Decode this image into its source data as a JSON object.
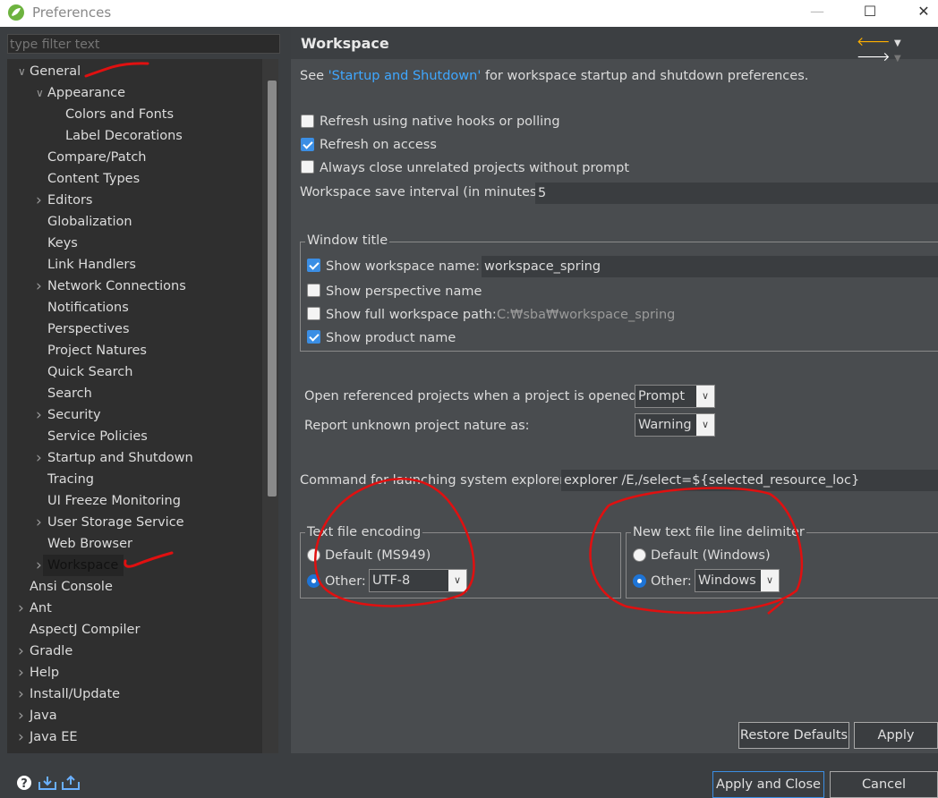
{
  "window": {
    "title": "Preferences"
  },
  "filter": {
    "placeholder": "type filter text"
  },
  "tree": [
    {
      "label": "General",
      "level": 0,
      "expanded": true,
      "icon": "chevron-down-icon"
    },
    {
      "label": "Appearance",
      "level": 1,
      "expanded": true,
      "icon": "chevron-down-icon"
    },
    {
      "label": "Colors and Fonts",
      "level": 2
    },
    {
      "label": "Label Decorations",
      "level": 2
    },
    {
      "label": "Compare/Patch",
      "level": 1
    },
    {
      "label": "Content Types",
      "level": 1
    },
    {
      "label": "Editors",
      "level": 1,
      "icon": "chevron-right-icon"
    },
    {
      "label": "Globalization",
      "level": 1
    },
    {
      "label": "Keys",
      "level": 1
    },
    {
      "label": "Link Handlers",
      "level": 1
    },
    {
      "label": "Network Connections",
      "level": 1,
      "icon": "chevron-right-icon"
    },
    {
      "label": "Notifications",
      "level": 1
    },
    {
      "label": "Perspectives",
      "level": 1
    },
    {
      "label": "Project Natures",
      "level": 1
    },
    {
      "label": "Quick Search",
      "level": 1
    },
    {
      "label": "Search",
      "level": 1
    },
    {
      "label": "Security",
      "level": 1,
      "icon": "chevron-right-icon"
    },
    {
      "label": "Service Policies",
      "level": 1
    },
    {
      "label": "Startup and Shutdown",
      "level": 1,
      "icon": "chevron-right-icon"
    },
    {
      "label": "Tracing",
      "level": 1
    },
    {
      "label": "UI Freeze Monitoring",
      "level": 1
    },
    {
      "label": "User Storage Service",
      "level": 1,
      "icon": "chevron-right-icon"
    },
    {
      "label": "Web Browser",
      "level": 1
    },
    {
      "label": "Workspace",
      "level": 1,
      "icon": "chevron-right-icon",
      "selected": true
    },
    {
      "label": "Ansi Console",
      "level": 0
    },
    {
      "label": "Ant",
      "level": 0,
      "icon": "chevron-right-icon"
    },
    {
      "label": "AspectJ Compiler",
      "level": 0
    },
    {
      "label": "Gradle",
      "level": 0,
      "icon": "chevron-right-icon"
    },
    {
      "label": "Help",
      "level": 0,
      "icon": "chevron-right-icon"
    },
    {
      "label": "Install/Update",
      "level": 0,
      "icon": "chevron-right-icon"
    },
    {
      "label": "Java",
      "level": 0,
      "icon": "chevron-right-icon"
    },
    {
      "label": "Java EE",
      "level": 0,
      "icon": "chevron-right-icon"
    }
  ],
  "page": {
    "title": "Workspace",
    "intro_pre": "See ",
    "intro_link": "'Startup and Shutdown'",
    "intro_post": " for workspace startup and shutdown preferences.",
    "refresh_native": {
      "label": "Refresh using native hooks or polling",
      "checked": false
    },
    "refresh_access": {
      "label": "Refresh on access",
      "checked": true
    },
    "always_close": {
      "label": "Always close unrelated projects without prompt",
      "checked": false
    },
    "save_interval_label": "Workspace save interval (in minutes):",
    "save_interval_value": "5",
    "window_title": {
      "group_label": "Window title",
      "show_workspace_name": {
        "label": "Show workspace name:",
        "checked": true,
        "value": "workspace_spring"
      },
      "show_perspective_name": {
        "label": "Show perspective name",
        "checked": false
      },
      "show_full_path": {
        "label": "Show full workspace path:",
        "checked": false,
        "value": "C:₩sba₩workspace_spring"
      },
      "show_product_name": {
        "label": "Show product name",
        "checked": true
      }
    },
    "open_referenced": {
      "label": "Open referenced projects when a project is opened:",
      "value": "Prompt"
    },
    "report_unknown": {
      "label": "Report unknown project nature as:",
      "value": "Warning"
    },
    "command_explorer": {
      "label": "Command for launching system explorer:",
      "value": "explorer /E,/select=${selected_resource_loc}"
    },
    "encoding": {
      "group_label": "Text file encoding",
      "default_label": "Default (MS949)",
      "other_label": "Other:",
      "other_value": "UTF-8",
      "selected": "other"
    },
    "line_delimiter": {
      "group_label": "New text file line delimiter",
      "default_label": "Default (Windows)",
      "other_label": "Other:",
      "other_value": "Windows",
      "selected": "other"
    },
    "restore_defaults": "Restore Defaults",
    "apply": "Apply"
  },
  "footer": {
    "apply_close": "Apply and Close",
    "cancel": "Cancel",
    "icons": [
      "help-icon",
      "import-icon",
      "export-icon"
    ]
  },
  "colors": {
    "accent": "#3b8ee4",
    "annotation": "#e01010",
    "link": "#3fa7ff"
  }
}
